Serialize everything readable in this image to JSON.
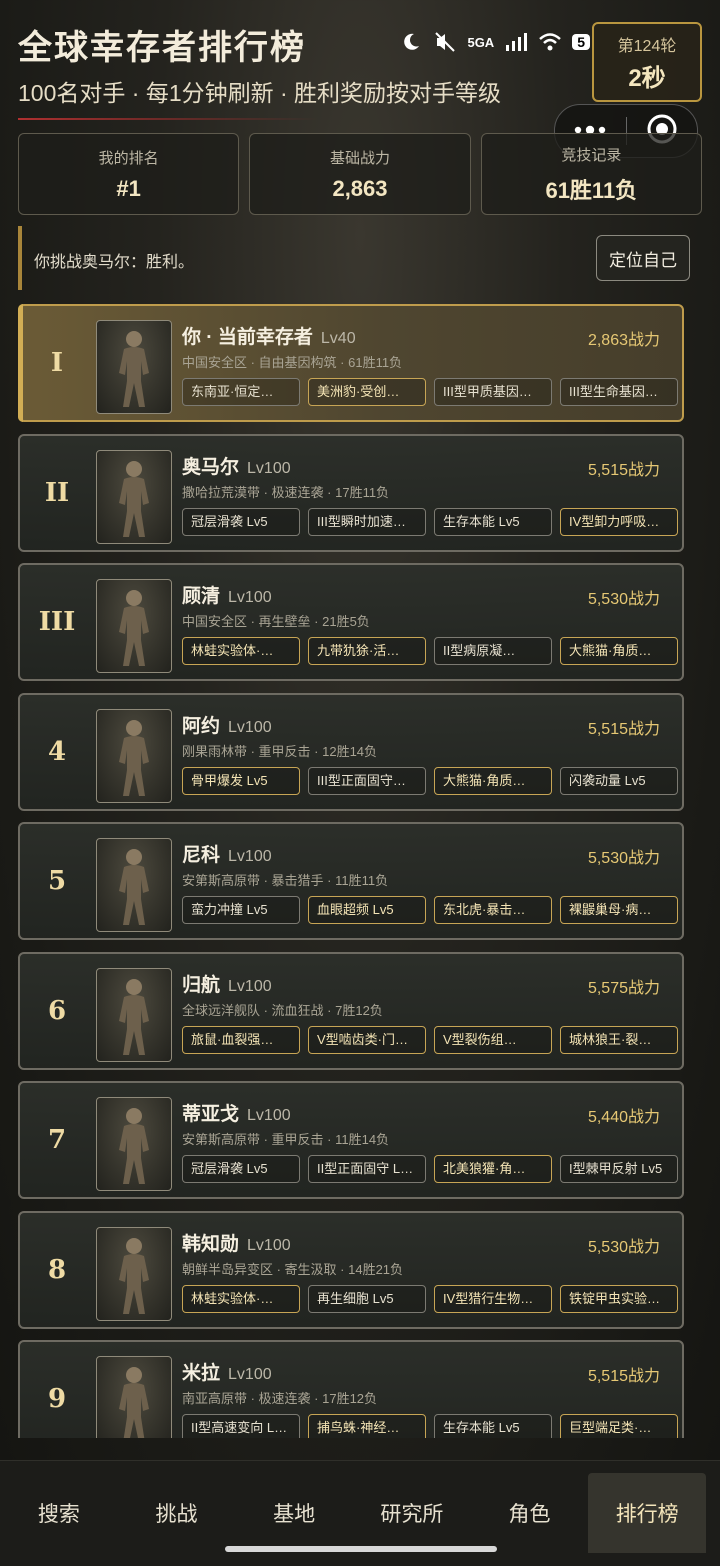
{
  "header": {
    "title": "全球幸存者排行榜",
    "subtitle": "100名对手 · 每1分钟刷新 · 胜利奖励按对手等级"
  },
  "status": {
    "network": "5GA",
    "battery": "5"
  },
  "round_box": {
    "label": "第124轮",
    "value": "2秒"
  },
  "stats": [
    {
      "label": "我的排名",
      "value": "#1"
    },
    {
      "label": "基础战力",
      "value": "2,863"
    },
    {
      "label": "竞技记录",
      "value": "61胜11负"
    }
  ],
  "message": {
    "text": "你挑战奥马尔：胜利。",
    "button": "定位自己"
  },
  "players": [
    {
      "rank": "I",
      "name": "你 · 当前幸存者",
      "level": "Lv40",
      "power": "2,863战力",
      "meta": "中国安全区 · 自由基因构筑 · 61胜11负",
      "tags": [
        {
          "text": "东南亚·恒定…",
          "gold": false
        },
        {
          "text": "美洲豹·受创…",
          "gold": true
        },
        {
          "text": "III型甲质基因…",
          "gold": false
        },
        {
          "text": "III型生命基因…",
          "gold": false
        }
      ]
    },
    {
      "rank": "II",
      "name": "奥马尔",
      "level": "Lv100",
      "power": "5,515战力",
      "meta": "撒哈拉荒漠带 · 极速连袭 · 17胜11负",
      "tags": [
        {
          "text": "冠层滑袭 Lv5",
          "gold": false
        },
        {
          "text": "III型瞬时加速…",
          "gold": false
        },
        {
          "text": "生存本能 Lv5",
          "gold": false
        },
        {
          "text": "IV型卸力呼吸…",
          "gold": true
        }
      ]
    },
    {
      "rank": "III",
      "name": "顾清",
      "level": "Lv100",
      "power": "5,530战力",
      "meta": "中国安全区 · 再生壁垒 · 21胜5负",
      "tags": [
        {
          "text": "林蛙实验体·…",
          "gold": true
        },
        {
          "text": "九带犰狳·活…",
          "gold": true
        },
        {
          "text": "II型病原凝…",
          "gold": false
        },
        {
          "text": "大熊猫·角质…",
          "gold": true
        }
      ]
    },
    {
      "rank": "4",
      "name": "阿约",
      "level": "Lv100",
      "power": "5,515战力",
      "meta": "刚果雨林带 · 重甲反击 · 12胜14负",
      "tags": [
        {
          "text": "骨甲爆发 Lv5",
          "gold": true
        },
        {
          "text": "III型正面固守…",
          "gold": false
        },
        {
          "text": "大熊猫·角质…",
          "gold": true
        },
        {
          "text": "闪袭动量 Lv5",
          "gold": false
        }
      ]
    },
    {
      "rank": "5",
      "name": "尼科",
      "level": "Lv100",
      "power": "5,530战力",
      "meta": "安第斯高原带 · 暴击猎手 · 11胜11负",
      "tags": [
        {
          "text": "蛮力冲撞 Lv5",
          "gold": false
        },
        {
          "text": "血眼超频 Lv5",
          "gold": true
        },
        {
          "text": "东北虎·暴击…",
          "gold": true
        },
        {
          "text": "裸鼹巢母·病…",
          "gold": true
        }
      ]
    },
    {
      "rank": "6",
      "name": "归航",
      "level": "Lv100",
      "power": "5,575战力",
      "meta": "全球远洋舰队 · 流血狂战 · 7胜12负",
      "tags": [
        {
          "text": "旅鼠·血裂强…",
          "gold": true
        },
        {
          "text": "V型啮齿类·门…",
          "gold": true
        },
        {
          "text": "V型裂伤组…",
          "gold": true
        },
        {
          "text": "城林狼王·裂…",
          "gold": true
        }
      ]
    },
    {
      "rank": "7",
      "name": "蒂亚戈",
      "level": "Lv100",
      "power": "5,440战力",
      "meta": "安第斯高原带 · 重甲反击 · 11胜14负",
      "tags": [
        {
          "text": "冠层滑袭 Lv5",
          "gold": false
        },
        {
          "text": "II型正面固守 L…",
          "gold": false
        },
        {
          "text": "北美狼獾·角…",
          "gold": true
        },
        {
          "text": "I型棘甲反射 Lv5",
          "gold": false
        }
      ]
    },
    {
      "rank": "8",
      "name": "韩知勋",
      "level": "Lv100",
      "power": "5,530战力",
      "meta": "朝鲜半岛异变区 · 寄生汲取 · 14胜21负",
      "tags": [
        {
          "text": "林蛙实验体·…",
          "gold": true
        },
        {
          "text": "再生细胞 Lv5",
          "gold": false
        },
        {
          "text": "IV型猎行生物…",
          "gold": true
        },
        {
          "text": "铁锭甲虫实验…",
          "gold": true
        }
      ]
    },
    {
      "rank": "9",
      "name": "米拉",
      "level": "Lv100",
      "power": "5,515战力",
      "meta": "南亚高原带 · 极速连袭 · 17胜12负",
      "tags": [
        {
          "text": "II型高速变向 L…",
          "gold": false
        },
        {
          "text": "捕鸟蛛·神经…",
          "gold": true
        },
        {
          "text": "生存本能 Lv5",
          "gold": false
        },
        {
          "text": "巨型端足类·…",
          "gold": true
        }
      ]
    }
  ],
  "nav": [
    "搜索",
    "挑战",
    "基地",
    "研究所",
    "角色",
    "排行榜"
  ]
}
